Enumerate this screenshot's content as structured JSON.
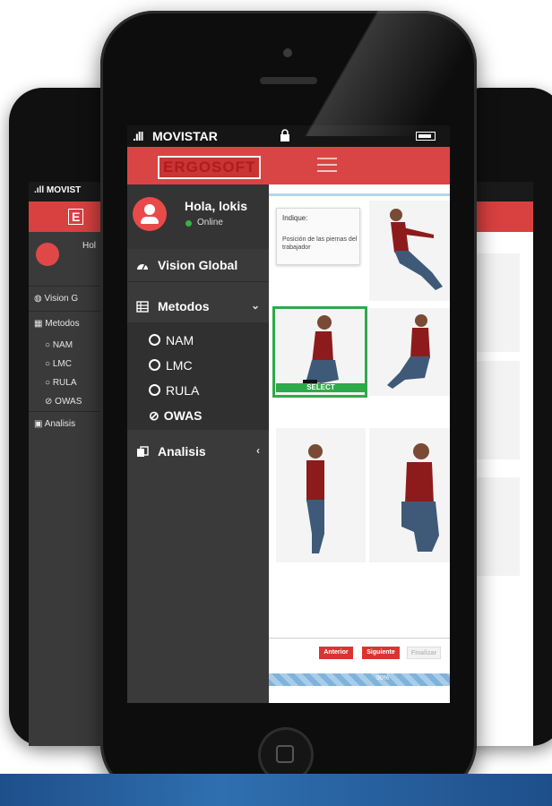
{
  "status": {
    "carrier": "MOVISTAR"
  },
  "app": {
    "logo_text": "ERGOSOFT"
  },
  "user": {
    "greeting": "Hola, lokis",
    "status": "Online"
  },
  "menu": {
    "vision": "Vision Global",
    "metodos": "Metodos",
    "submenu": [
      "NAM",
      "LMC",
      "RULA",
      "OWAS"
    ],
    "analisis": "Analisis"
  },
  "content": {
    "indique_title": "Indique:",
    "indique_text": "Posición de las piernas del trabajador",
    "select_label": "SELECT",
    "buttons": {
      "prev": "Anterior",
      "next": "Siguiente",
      "finish": "Finalizar"
    },
    "footer_label": "90%"
  },
  "background_phone": {
    "carrier": "MOVIST",
    "greeting": "Hol",
    "vision": "Vision G",
    "metodos": "Metodos",
    "submenu": [
      "NAM",
      "LMC",
      "RULA",
      "OWAS"
    ],
    "analisis": "Analisis"
  },
  "colors": {
    "brand_red": "#d94545",
    "select_green": "#2eaa4a",
    "online_green": "#3cb043",
    "sidebar": "#3a3a3a"
  },
  "icons": [
    "signal-icon",
    "lock-icon",
    "battery-icon",
    "hamburger-icon",
    "dashboard-icon",
    "table-icon",
    "copy-icon",
    "chevron-down-icon",
    "chevron-left-icon"
  ]
}
